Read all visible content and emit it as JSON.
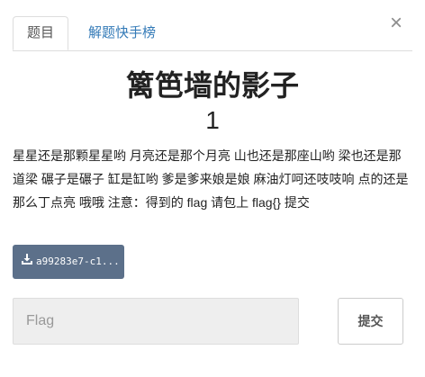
{
  "close_glyph": "×",
  "tabs": [
    {
      "label": "题目",
      "active": true
    },
    {
      "label": "解题快手榜",
      "active": false
    }
  ],
  "challenge": {
    "title": "篱笆墙的影子",
    "points": "1",
    "description": "星星还是那颗星星哟 月亮还是那个月亮 山也还是那座山哟 梁也还是那道梁 碾子是碾子 缸是缸哟 爹是爹来娘是娘 麻油灯呵还吱吱响 点的还是那么丁点亮 哦哦 注意：得到的 flag 请包上 flag{} 提交"
  },
  "attachment": {
    "label": "a99283e7-c1...",
    "icon": "download-icon"
  },
  "flag_form": {
    "placeholder": "Flag",
    "value": "",
    "submit_label": "提交"
  },
  "colors": {
    "link": "#337ab7",
    "download_button": "#5c708a"
  }
}
